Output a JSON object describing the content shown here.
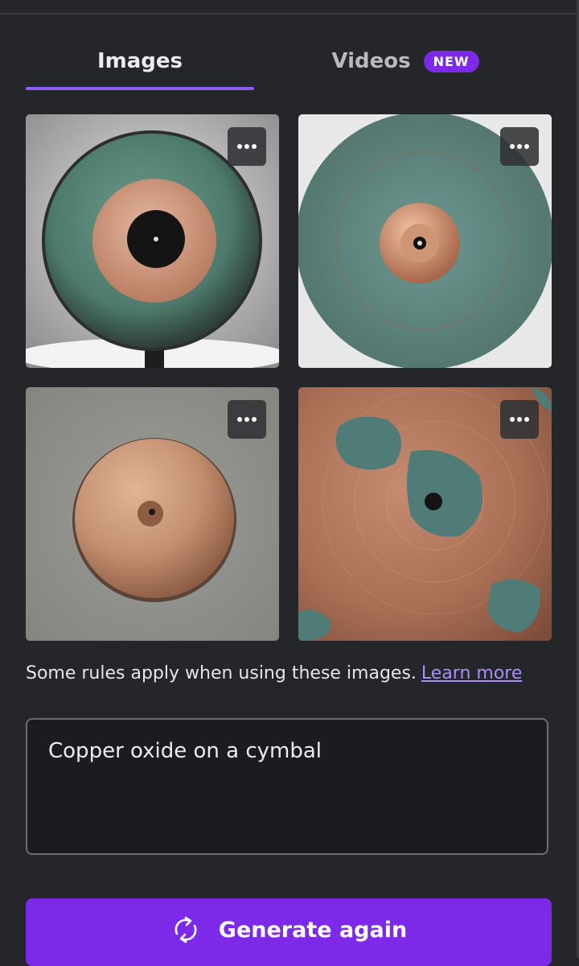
{
  "tabs": {
    "images_label": "Images",
    "videos_label": "Videos",
    "videos_badge": "NEW",
    "active": "Images"
  },
  "gallery": {
    "items": [
      {
        "description": "cymbal-green-copper-center",
        "menu_icon": "more-horizontal-icon"
      },
      {
        "description": "cymbal-patina-top-view",
        "menu_icon": "more-horizontal-icon"
      },
      {
        "description": "copper-cymbal-on-gray",
        "menu_icon": "more-horizontal-icon"
      },
      {
        "description": "copper-cymbal-closeup-patina",
        "menu_icon": "more-horizontal-icon"
      }
    ]
  },
  "notice": {
    "text": "Some rules apply when using these images.",
    "link": "Learn more"
  },
  "prompt": {
    "value": "Copper oxide on a cymbal"
  },
  "generate": {
    "label": "Generate again",
    "icon": "refresh-icon"
  },
  "colors": {
    "accent": "#7d2ae8",
    "tab_underline": "#8b5cf6",
    "link": "#a98ef7",
    "background": "#252629"
  }
}
